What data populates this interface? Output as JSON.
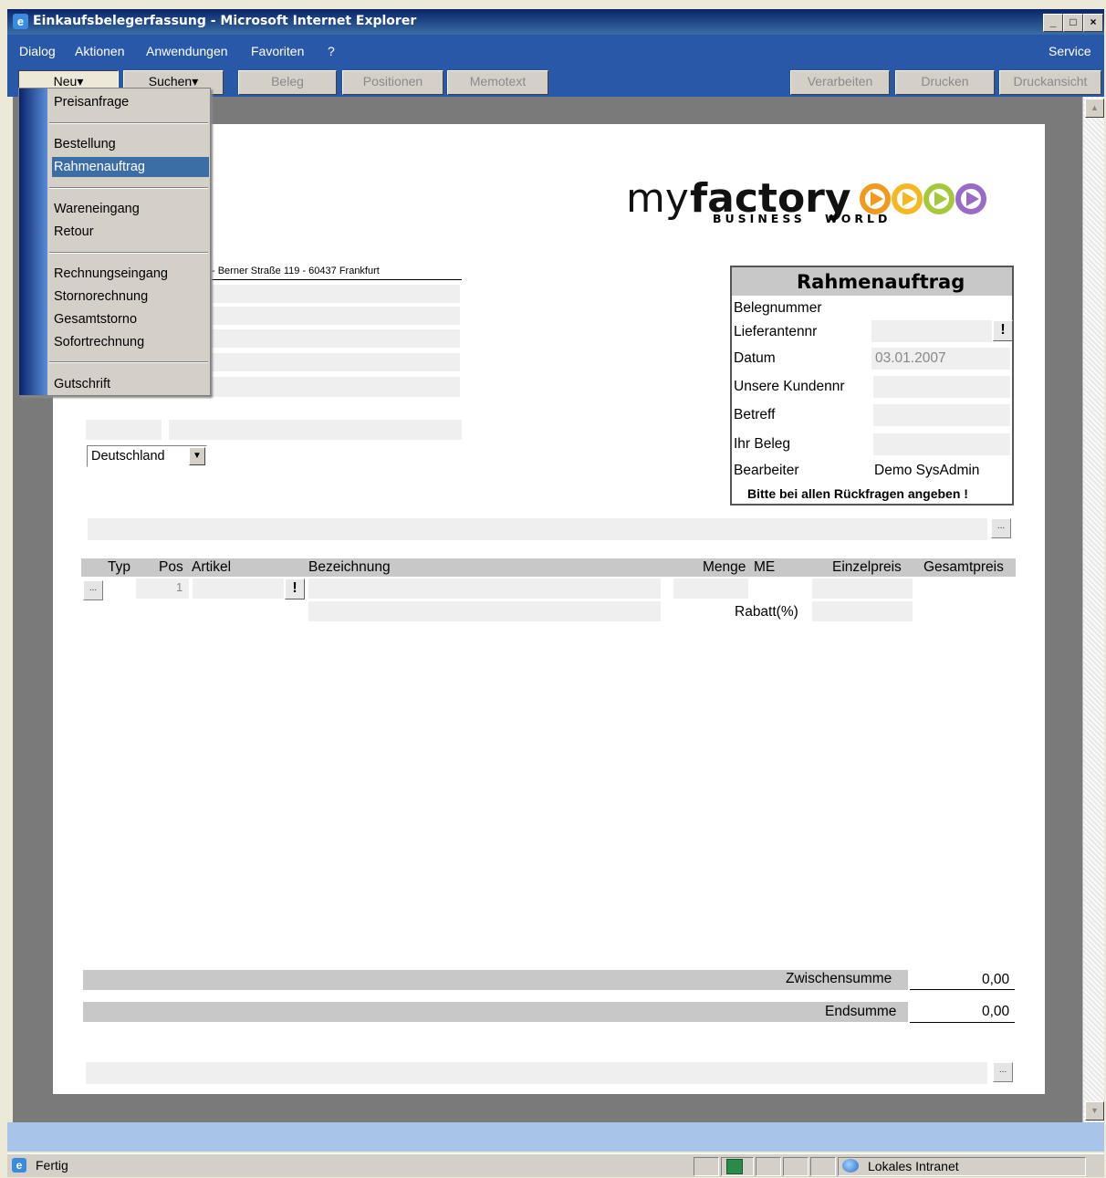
{
  "window": {
    "title": "Einkaufsbelegerfassung - Microsoft Internet Explorer",
    "min": "_",
    "max": "□",
    "close": "×"
  },
  "menubar": {
    "items": [
      "Dialog",
      "Aktionen",
      "Anwendungen",
      "Favoriten",
      "?"
    ],
    "service": "Service"
  },
  "toolbar": {
    "neu": "Neu▾",
    "suchen": "Suchen▾",
    "beleg": "Beleg",
    "positionen": "Positionen",
    "memotext": "Memotext",
    "verarbeiten": "Verarbeiten",
    "drucken": "Drucken",
    "druckansicht": "Druckansicht"
  },
  "dropdown": {
    "items": [
      "Preisanfrage",
      "Bestellung",
      "Rahmenauftrag",
      "Wareneingang",
      "Retour",
      "Rechnungseingang",
      "Stornorechnung",
      "Gesamtstorno",
      "Sofortrechnung",
      "Gutschrift"
    ],
    "selected": "Rahmenauftrag"
  },
  "logo": {
    "text_my": "my",
    "text_factory": "factory",
    "sub1": "BUSINESS",
    "sub2": "WORLD"
  },
  "address": {
    "sender_line": "- Berner Straße 119 - 60437 Frankfurt",
    "country": "Deutschland"
  },
  "docbox": {
    "title": "Rahmenauftrag",
    "belegnummer_label": "Belegnummer",
    "lieferantennr_label": "Lieferantennr",
    "datum_label": "Datum",
    "datum_value": "03.01.2007",
    "kundennr_label": "Unsere Kundennr",
    "betreff_label": "Betreff",
    "ihrbeleg_label": "Ihr Beleg",
    "bearbeiter_label": "Bearbeiter",
    "bearbeiter_value": "Demo SysAdmin",
    "note": "Bitte bei allen Rückfragen angeben !"
  },
  "positions": {
    "headers": {
      "typ": "Typ",
      "pos": "Pos",
      "artikel": "Artikel",
      "bezeichnung": "Bezeichnung",
      "menge": "Menge",
      "me": "ME",
      "einzelpreis": "Einzelpreis",
      "gesamtpreis": "Gesamtpreis"
    },
    "row_pos": "1",
    "rabatt_label": "Rabatt(%)"
  },
  "totals": {
    "zwischensumme_label": "Zwischensumme",
    "zwischensumme_value": "0,00",
    "endsumme_label": "Endsumme",
    "endsumme_value": "0,00"
  },
  "status": {
    "text": "Fertig",
    "zone": "Lokales Intranet"
  },
  "icons": {
    "ie": "e",
    "ellipsis": "...",
    "exclaim": "!",
    "dropdown_arrow": "▼",
    "scroll_up": "▲",
    "scroll_down": "▼"
  }
}
